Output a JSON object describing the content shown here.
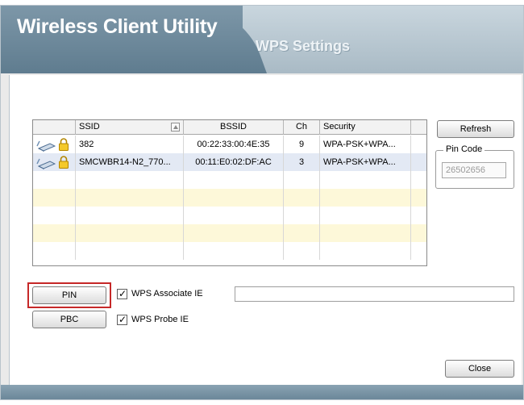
{
  "header": {
    "app_title": "Wireless Client Utility",
    "section_title": "WPS Settings"
  },
  "table": {
    "columns": [
      "SSID",
      "BSSID",
      "Ch",
      "Security"
    ],
    "rows": [
      {
        "ssid": "382",
        "bssid": "00:22:33:00:4E:35",
        "ch": "9",
        "security": "WPA-PSK+WPA...",
        "icon": "network-icon",
        "lock": "lock-icon",
        "selected": false
      },
      {
        "ssid": "SMCWBR14-N2_770...",
        "bssid": "00:11:E0:02:DF:AC",
        "ch": "3",
        "security": "WPA-PSK+WPA...",
        "icon": "network-icon",
        "lock": "lock-icon",
        "selected": true
      }
    ]
  },
  "buttons": {
    "refresh": "Refresh",
    "pin": "PIN",
    "pbc": "PBC",
    "close": "Close"
  },
  "pin_code": {
    "legend": "Pin Code",
    "value": "26502656"
  },
  "options": {
    "wps_associate_ie": {
      "label": "WPS Associate IE",
      "checked": true
    },
    "wps_probe_ie": {
      "label": "WPS Probe IE",
      "checked": true
    }
  },
  "colors": {
    "highlight": "#c62828",
    "selected_row": "#e3e9f4",
    "alt_row": "#fdf8d9"
  }
}
